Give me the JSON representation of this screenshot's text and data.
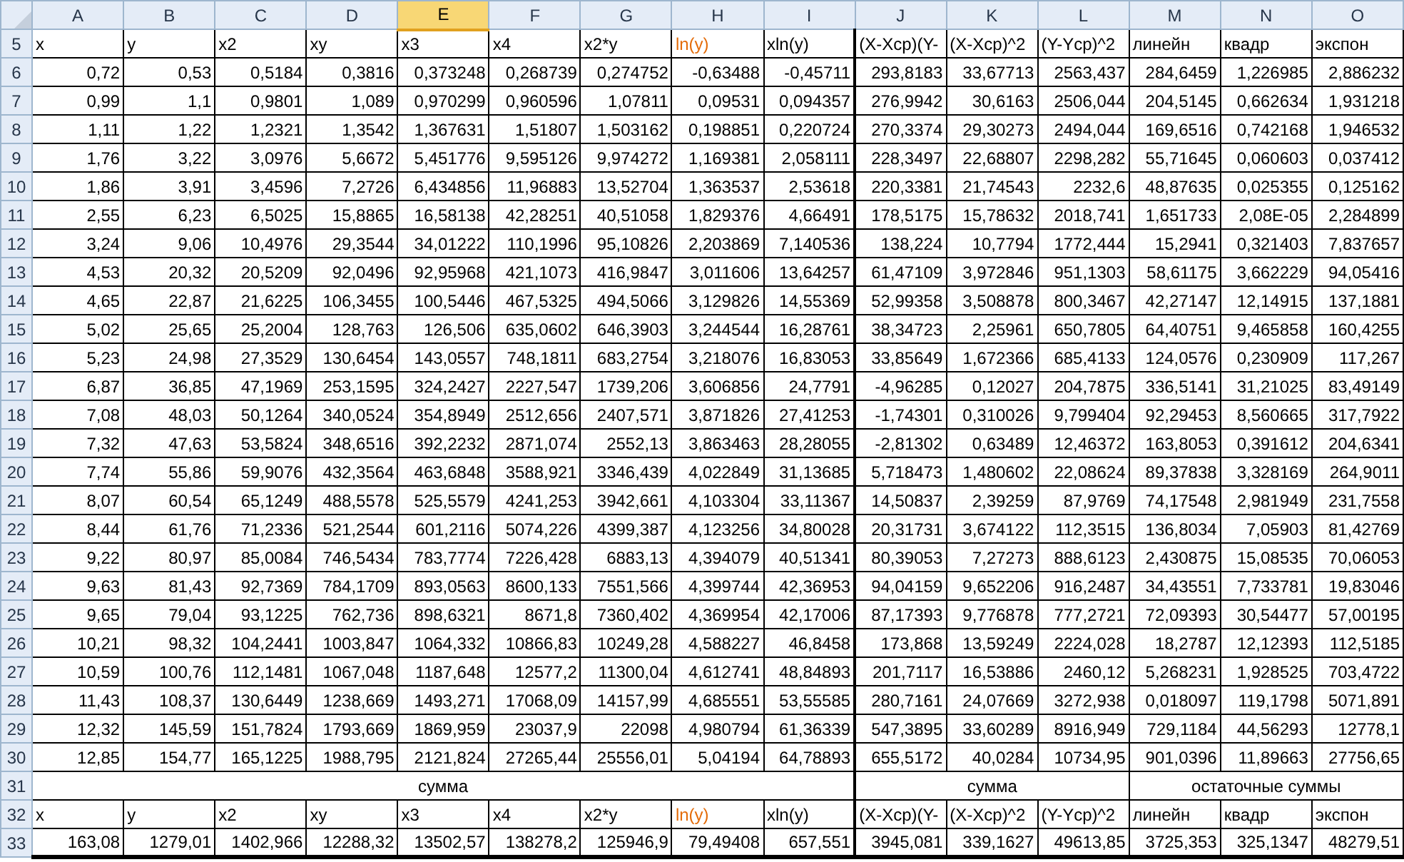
{
  "columns": [
    {
      "label": "A",
      "selected": false
    },
    {
      "label": "B",
      "selected": false
    },
    {
      "label": "C",
      "selected": false
    },
    {
      "label": "D",
      "selected": false
    },
    {
      "label": "E",
      "selected": true
    },
    {
      "label": "F",
      "selected": false
    },
    {
      "label": "G",
      "selected": false
    },
    {
      "label": "H",
      "selected": false
    },
    {
      "label": "I",
      "selected": false
    },
    {
      "label": "J",
      "selected": false
    },
    {
      "label": "K",
      "selected": false
    },
    {
      "label": "L",
      "selected": false
    },
    {
      "label": "M",
      "selected": false
    },
    {
      "label": "N",
      "selected": false
    },
    {
      "label": "O",
      "selected": false
    }
  ],
  "rows": [
    {
      "number": "5",
      "kind": "labels",
      "cells": [
        {
          "text": "x",
          "color": "#000000"
        },
        {
          "text": "y",
          "color": "#000000"
        },
        {
          "text": "x2",
          "color": "#000000"
        },
        {
          "text": "xy",
          "color": "#000000"
        },
        {
          "text": "x3",
          "color": "#000000"
        },
        {
          "text": "x4",
          "color": "#000000"
        },
        {
          "text": "x2*y",
          "color": "#000000"
        },
        {
          "text": "ln(y)",
          "color": "#e46c0a"
        },
        {
          "text": "xln(y)",
          "color": "#000000"
        },
        {
          "text": "(X-Xcp)(Y-",
          "color": "#000000"
        },
        {
          "text": "(X-Xcp)^2",
          "color": "#000000"
        },
        {
          "text": "(Y-Ycp)^2",
          "color": "#000000"
        },
        {
          "text": "линейн",
          "color": "#000000"
        },
        {
          "text": "квадр",
          "color": "#000000"
        },
        {
          "text": "экспон",
          "color": "#000000"
        }
      ]
    },
    {
      "number": "6",
      "kind": "values",
      "cells": [
        "0,72",
        "0,53",
        "0,5184",
        "0,3816",
        "0,373248",
        "0,268739",
        "0,274752",
        "-0,63488",
        "-0,45711",
        "293,8183",
        "33,67713",
        "2563,437",
        "284,6459",
        "1,226985",
        "2,886232"
      ]
    },
    {
      "number": "7",
      "kind": "values",
      "cells": [
        "0,99",
        "1,1",
        "0,9801",
        "1,089",
        "0,970299",
        "0,960596",
        "1,07811",
        "0,09531",
        "0,094357",
        "276,9942",
        "30,6163",
        "2506,044",
        "204,5145",
        "0,662634",
        "1,931218"
      ]
    },
    {
      "number": "8",
      "kind": "values",
      "cells": [
        "1,11",
        "1,22",
        "1,2321",
        "1,3542",
        "1,367631",
        "1,51807",
        "1,503162",
        "0,198851",
        "0,220724",
        "270,3374",
        "29,30273",
        "2494,044",
        "169,6516",
        "0,742168",
        "1,946532"
      ]
    },
    {
      "number": "9",
      "kind": "values",
      "cells": [
        "1,76",
        "3,22",
        "3,0976",
        "5,6672",
        "5,451776",
        "9,595126",
        "9,974272",
        "1,169381",
        "2,058111",
        "228,3497",
        "22,68807",
        "2298,282",
        "55,71645",
        "0,060603",
        "0,037412"
      ]
    },
    {
      "number": "10",
      "kind": "values",
      "cells": [
        "1,86",
        "3,91",
        "3,4596",
        "7,2726",
        "6,434856",
        "11,96883",
        "13,52704",
        "1,363537",
        "2,53618",
        "220,3381",
        "21,74543",
        "2232,6",
        "48,87635",
        "0,025355",
        "0,125162"
      ]
    },
    {
      "number": "11",
      "kind": "values",
      "cells": [
        "2,55",
        "6,23",
        "6,5025",
        "15,8865",
        "16,58138",
        "42,28251",
        "40,51058",
        "1,829376",
        "4,66491",
        "178,5175",
        "15,78632",
        "2018,741",
        "1,651733",
        "2,08E-05",
        "2,284899"
      ]
    },
    {
      "number": "12",
      "kind": "values",
      "cells": [
        "3,24",
        "9,06",
        "10,4976",
        "29,3544",
        "34,01222",
        "110,1996",
        "95,10826",
        "2,203869",
        "7,140536",
        "138,224",
        "10,7794",
        "1772,444",
        "15,2941",
        "0,321403",
        "7,837657"
      ]
    },
    {
      "number": "13",
      "kind": "values",
      "cells": [
        "4,53",
        "20,32",
        "20,5209",
        "92,0496",
        "92,95968",
        "421,1073",
        "416,9847",
        "3,011606",
        "13,64257",
        "61,47109",
        "3,972846",
        "951,1303",
        "58,61175",
        "3,662229",
        "94,05416"
      ]
    },
    {
      "number": "14",
      "kind": "values",
      "cells": [
        "4,65",
        "22,87",
        "21,6225",
        "106,3455",
        "100,5446",
        "467,5325",
        "494,5066",
        "3,129826",
        "14,55369",
        "52,99358",
        "3,508878",
        "800,3467",
        "42,27147",
        "12,14915",
        "137,1881"
      ]
    },
    {
      "number": "15",
      "kind": "values",
      "cells": [
        "5,02",
        "25,65",
        "25,2004",
        "128,763",
        "126,506",
        "635,0602",
        "646,3903",
        "3,244544",
        "16,28761",
        "38,34723",
        "2,25961",
        "650,7805",
        "64,40751",
        "9,465858",
        "160,4255"
      ]
    },
    {
      "number": "16",
      "kind": "values",
      "cells": [
        "5,23",
        "24,98",
        "27,3529",
        "130,6454",
        "143,0557",
        "748,1811",
        "683,2754",
        "3,218076",
        "16,83053",
        "33,85649",
        "1,672366",
        "685,4133",
        "124,0576",
        "0,230909",
        "117,267"
      ]
    },
    {
      "number": "17",
      "kind": "values",
      "cells": [
        "6,87",
        "36,85",
        "47,1969",
        "253,1595",
        "324,2427",
        "2227,547",
        "1739,206",
        "3,606856",
        "24,7791",
        "-4,96285",
        "0,12027",
        "204,7875",
        "336,5141",
        "31,21025",
        "83,49149"
      ]
    },
    {
      "number": "18",
      "kind": "values",
      "cells": [
        "7,08",
        "48,03",
        "50,1264",
        "340,0524",
        "354,8949",
        "2512,656",
        "2407,571",
        "3,871826",
        "27,41253",
        "-1,74301",
        "0,310026",
        "9,799404",
        "92,29453",
        "8,560665",
        "317,7922"
      ]
    },
    {
      "number": "19",
      "kind": "values",
      "cells": [
        "7,32",
        "47,63",
        "53,5824",
        "348,6516",
        "392,2232",
        "2871,074",
        "2552,13",
        "3,863463",
        "28,28055",
        "-2,81302",
        "0,63489",
        "12,46372",
        "163,8053",
        "0,391612",
        "204,6341"
      ]
    },
    {
      "number": "20",
      "kind": "values",
      "cells": [
        "7,74",
        "55,86",
        "59,9076",
        "432,3564",
        "463,6848",
        "3588,921",
        "3346,439",
        "4,022849",
        "31,13685",
        "5,718473",
        "1,480602",
        "22,08624",
        "89,37838",
        "3,328169",
        "264,9011"
      ]
    },
    {
      "number": "21",
      "kind": "values",
      "cells": [
        "8,07",
        "60,54",
        "65,1249",
        "488,5578",
        "525,5579",
        "4241,253",
        "3942,661",
        "4,103304",
        "33,11367",
        "14,50837",
        "2,39259",
        "87,9769",
        "74,17548",
        "2,981949",
        "231,7558"
      ]
    },
    {
      "number": "22",
      "kind": "values",
      "cells": [
        "8,44",
        "61,76",
        "71,2336",
        "521,2544",
        "601,2116",
        "5074,226",
        "4399,387",
        "4,123256",
        "34,80028",
        "20,31731",
        "3,674122",
        "112,3515",
        "136,8034",
        "7,05903",
        "81,42769"
      ]
    },
    {
      "number": "23",
      "kind": "values",
      "cells": [
        "9,22",
        "80,97",
        "85,0084",
        "746,5434",
        "783,7774",
        "7226,428",
        "6883,13",
        "4,394079",
        "40,51341",
        "80,39053",
        "7,27273",
        "888,6123",
        "2,430875",
        "15,08535",
        "70,06053"
      ]
    },
    {
      "number": "24",
      "kind": "values",
      "cells": [
        "9,63",
        "81,43",
        "92,7369",
        "784,1709",
        "893,0563",
        "8600,133",
        "7551,566",
        "4,399744",
        "42,36953",
        "94,04159",
        "9,652206",
        "916,2487",
        "34,43551",
        "7,733781",
        "19,83046"
      ]
    },
    {
      "number": "25",
      "kind": "values",
      "cells": [
        "9,65",
        "79,04",
        "93,1225",
        "762,736",
        "898,6321",
        "8671,8",
        "7360,402",
        "4,369954",
        "42,17006",
        "87,17393",
        "9,776878",
        "777,2721",
        "72,09393",
        "30,54477",
        "57,00195"
      ]
    },
    {
      "number": "26",
      "kind": "values",
      "cells": [
        "10,21",
        "98,32",
        "104,2441",
        "1003,847",
        "1064,332",
        "10866,83",
        "10249,28",
        "4,588227",
        "46,8458",
        "173,868",
        "13,59249",
        "2224,028",
        "18,2787",
        "12,12393",
        "112,5185"
      ]
    },
    {
      "number": "27",
      "kind": "values",
      "cells": [
        "10,59",
        "100,76",
        "112,1481",
        "1067,048",
        "1187,648",
        "12577,2",
        "11300,04",
        "4,612741",
        "48,84893",
        "201,7117",
        "16,53886",
        "2460,12",
        "5,268231",
        "1,928525",
        "703,4722"
      ]
    },
    {
      "number": "28",
      "kind": "values",
      "cells": [
        "11,43",
        "108,37",
        "130,6449",
        "1238,669",
        "1493,271",
        "17068,09",
        "14157,99",
        "4,685551",
        "53,55585",
        "280,7161",
        "24,07669",
        "3272,938",
        "0,018097",
        "119,1798",
        "5071,891"
      ]
    },
    {
      "number": "29",
      "kind": "values",
      "cells": [
        "12,32",
        "145,59",
        "151,7824",
        "1793,669",
        "1869,959",
        "23037,9",
        "22098",
        "4,980794",
        "61,36339",
        "547,3895",
        "33,60289",
        "8916,949",
        "729,1184",
        "44,56293",
        "12778,1"
      ]
    },
    {
      "number": "30",
      "kind": "values",
      "cells": [
        "12,85",
        "154,77",
        "165,1225",
        "1988,795",
        "2121,824",
        "27265,44",
        "25556,01",
        "5,04194",
        "64,78893",
        "655,5172",
        "40,0284",
        "10734,95",
        "901,0396",
        "11,89663",
        "27756,65"
      ]
    },
    {
      "number": "31",
      "kind": "groups",
      "cells": [
        "сумма",
        null,
        null,
        null,
        null,
        null,
        null,
        null,
        null,
        "сумма",
        null,
        null,
        "остаточные суммы",
        null,
        null
      ]
    },
    {
      "number": "32",
      "kind": "labels",
      "cells": [
        {
          "text": "x",
          "color": "#000000"
        },
        {
          "text": "y",
          "color": "#000000"
        },
        {
          "text": "x2",
          "color": "#000000"
        },
        {
          "text": "xy",
          "color": "#000000"
        },
        {
          "text": "x3",
          "color": "#000000"
        },
        {
          "text": "x4",
          "color": "#000000"
        },
        {
          "text": "x2*y",
          "color": "#000000"
        },
        {
          "text": "ln(y)",
          "color": "#e46c0a"
        },
        {
          "text": "xln(y)",
          "color": "#000000"
        },
        {
          "text": "(X-Xcp)(Y-",
          "color": "#000000"
        },
        {
          "text": "(X-Xcp)^2",
          "color": "#000000"
        },
        {
          "text": "(Y-Ycp)^2",
          "color": "#000000"
        },
        {
          "text": "линейн",
          "color": "#000000"
        },
        {
          "text": "квадр",
          "color": "#000000"
        },
        {
          "text": "экспон",
          "color": "#000000"
        }
      ]
    },
    {
      "number": "33",
      "kind": "values",
      "cells": [
        "163,08",
        "1279,01",
        "1402,966",
        "12288,32",
        "13502,57",
        "138278,2",
        "125946,9",
        "79,49408",
        "657,551",
        "3945,081",
        "339,1627",
        "49613,85",
        "3725,353",
        "325,1347",
        "48279,51"
      ]
    }
  ]
}
